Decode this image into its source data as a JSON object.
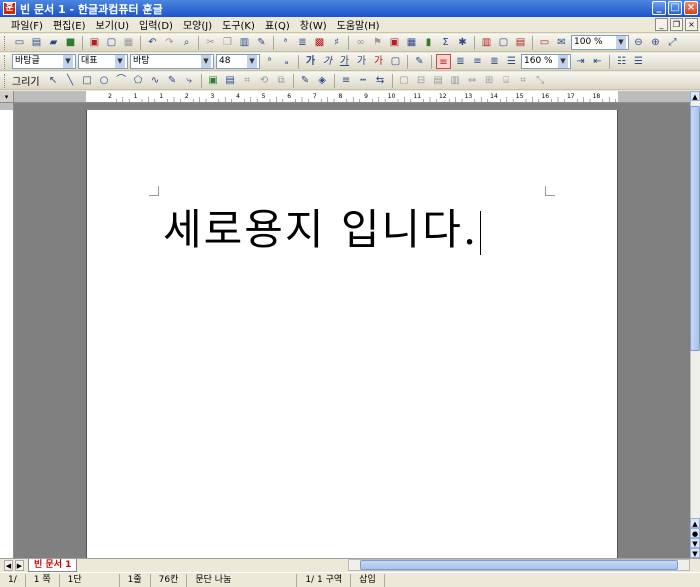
{
  "window": {
    "title": "빈 문서 1 - 한글과컴퓨터 훈글",
    "app_icon": "훈",
    "controls": {
      "minimize": "_",
      "maximize": "□",
      "close": "×"
    }
  },
  "menu": {
    "items": [
      "파일(F)",
      "편집(E)",
      "보기(U)",
      "입력(D)",
      "모양(J)",
      "도구(K)",
      "표(Q)",
      "창(W)",
      "도움말(H)"
    ],
    "doc_controls": {
      "minimize": "_",
      "restore": "❐",
      "close": "×"
    }
  },
  "toolbar1": {
    "zoom_value": "100 %"
  },
  "toolbar2": {
    "style_value": "바탕글",
    "language_value": "대표",
    "font_value": "바탕",
    "font_size_value": "48",
    "line_spacing_value": "160 %"
  },
  "toolbar3": {
    "draw_label": "그리기"
  },
  "ruler": {
    "corner": "▾",
    "ticks": [
      "2",
      "1",
      "1",
      "2",
      "3",
      "4",
      "5",
      "6",
      "7",
      "8",
      "9",
      "10",
      "11",
      "12",
      "13",
      "14",
      "15",
      "16",
      "17",
      "18"
    ]
  },
  "document": {
    "text": "세로용지 입니다."
  },
  "tabs": {
    "doc_tab": "빈 문서 1"
  },
  "status": {
    "page": "1/",
    "page_num": "1 쪽",
    "column": "1단",
    "line": "1줄",
    "char": "76칸",
    "paragraph": "문단 나눔",
    "section": "1/  1 구역",
    "mode": "삽입"
  }
}
